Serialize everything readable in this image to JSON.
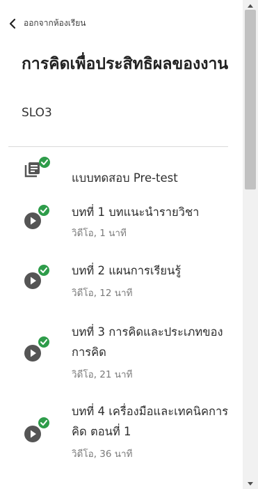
{
  "nav": {
    "back_label": "ออกจากห้องเรียน"
  },
  "course": {
    "title": "การคิดเพื่อประสิทธิผลของงาน",
    "code": "SLO3"
  },
  "colors": {
    "complete_check": "#2e9c4a",
    "icon_dark": "#555555"
  },
  "lessons": [
    {
      "icon": "quiz-icon",
      "title": "แบบทดสอบ Pre-test",
      "meta": "",
      "completed": true
    },
    {
      "icon": "video-play-icon",
      "title": "บทที่ 1 บทแนะนำรายวิชา",
      "meta": "วิดีโอ, 1 นาที",
      "completed": true
    },
    {
      "icon": "video-play-icon",
      "title": "บทที่ 2 แผนการเรียนรู้",
      "meta": "วิดีโอ, 12 นาที",
      "completed": true
    },
    {
      "icon": "video-play-icon",
      "title": "บทที่ 3 การคิดและประเภทของการคิด",
      "meta": "วิดีโอ, 21 นาที",
      "completed": true
    },
    {
      "icon": "video-play-icon",
      "title": "บทที่ 4 เครื่องมือและเทคนิคการคิด ตอนที่ 1",
      "meta": "วิดีโอ, 36 นาที",
      "completed": true
    }
  ]
}
